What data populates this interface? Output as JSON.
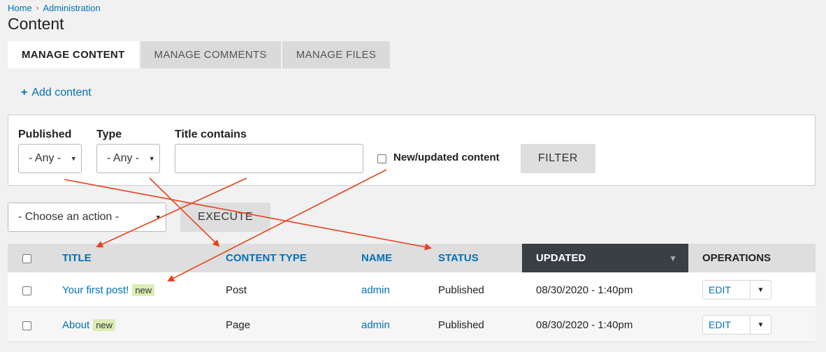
{
  "breadcrumb": {
    "home": "Home",
    "separator": "›",
    "admin": "Administration"
  },
  "page_title": "Content",
  "tabs": [
    {
      "label": "MANAGE CONTENT"
    },
    {
      "label": "MANAGE COMMENTS"
    },
    {
      "label": "MANAGE FILES"
    }
  ],
  "add_content": {
    "icon": "+",
    "label": "Add content"
  },
  "filters": {
    "published": {
      "label": "Published",
      "value": "- Any -"
    },
    "type": {
      "label": "Type",
      "value": "- Any -"
    },
    "title": {
      "label": "Title contains",
      "value": ""
    },
    "new_updated": {
      "label": "New/updated content",
      "checked": false
    },
    "filter_button": "FILTER"
  },
  "bulk": {
    "action_select": "- Choose an action -",
    "execute_button": "EXECUTE"
  },
  "table": {
    "headers": {
      "title": "TITLE",
      "content_type": "CONTENT TYPE",
      "name": "NAME",
      "status": "STATUS",
      "updated": "UPDATED",
      "operations": "OPERATIONS"
    },
    "rows": [
      {
        "title": "Your first post!",
        "badge": "new",
        "type": "Post",
        "name": "admin",
        "status": "Published",
        "updated": "08/30/2020 - 1:40pm",
        "op": "EDIT"
      },
      {
        "title": "About",
        "badge": "new",
        "type": "Page",
        "name": "admin",
        "status": "Published",
        "updated": "08/30/2020 - 1:40pm",
        "op": "EDIT"
      }
    ]
  },
  "colors": {
    "link": "#0071b8",
    "annotation_arrow": "#e8401c",
    "sort_header": "#393f44",
    "badge": "#dbedb4"
  }
}
